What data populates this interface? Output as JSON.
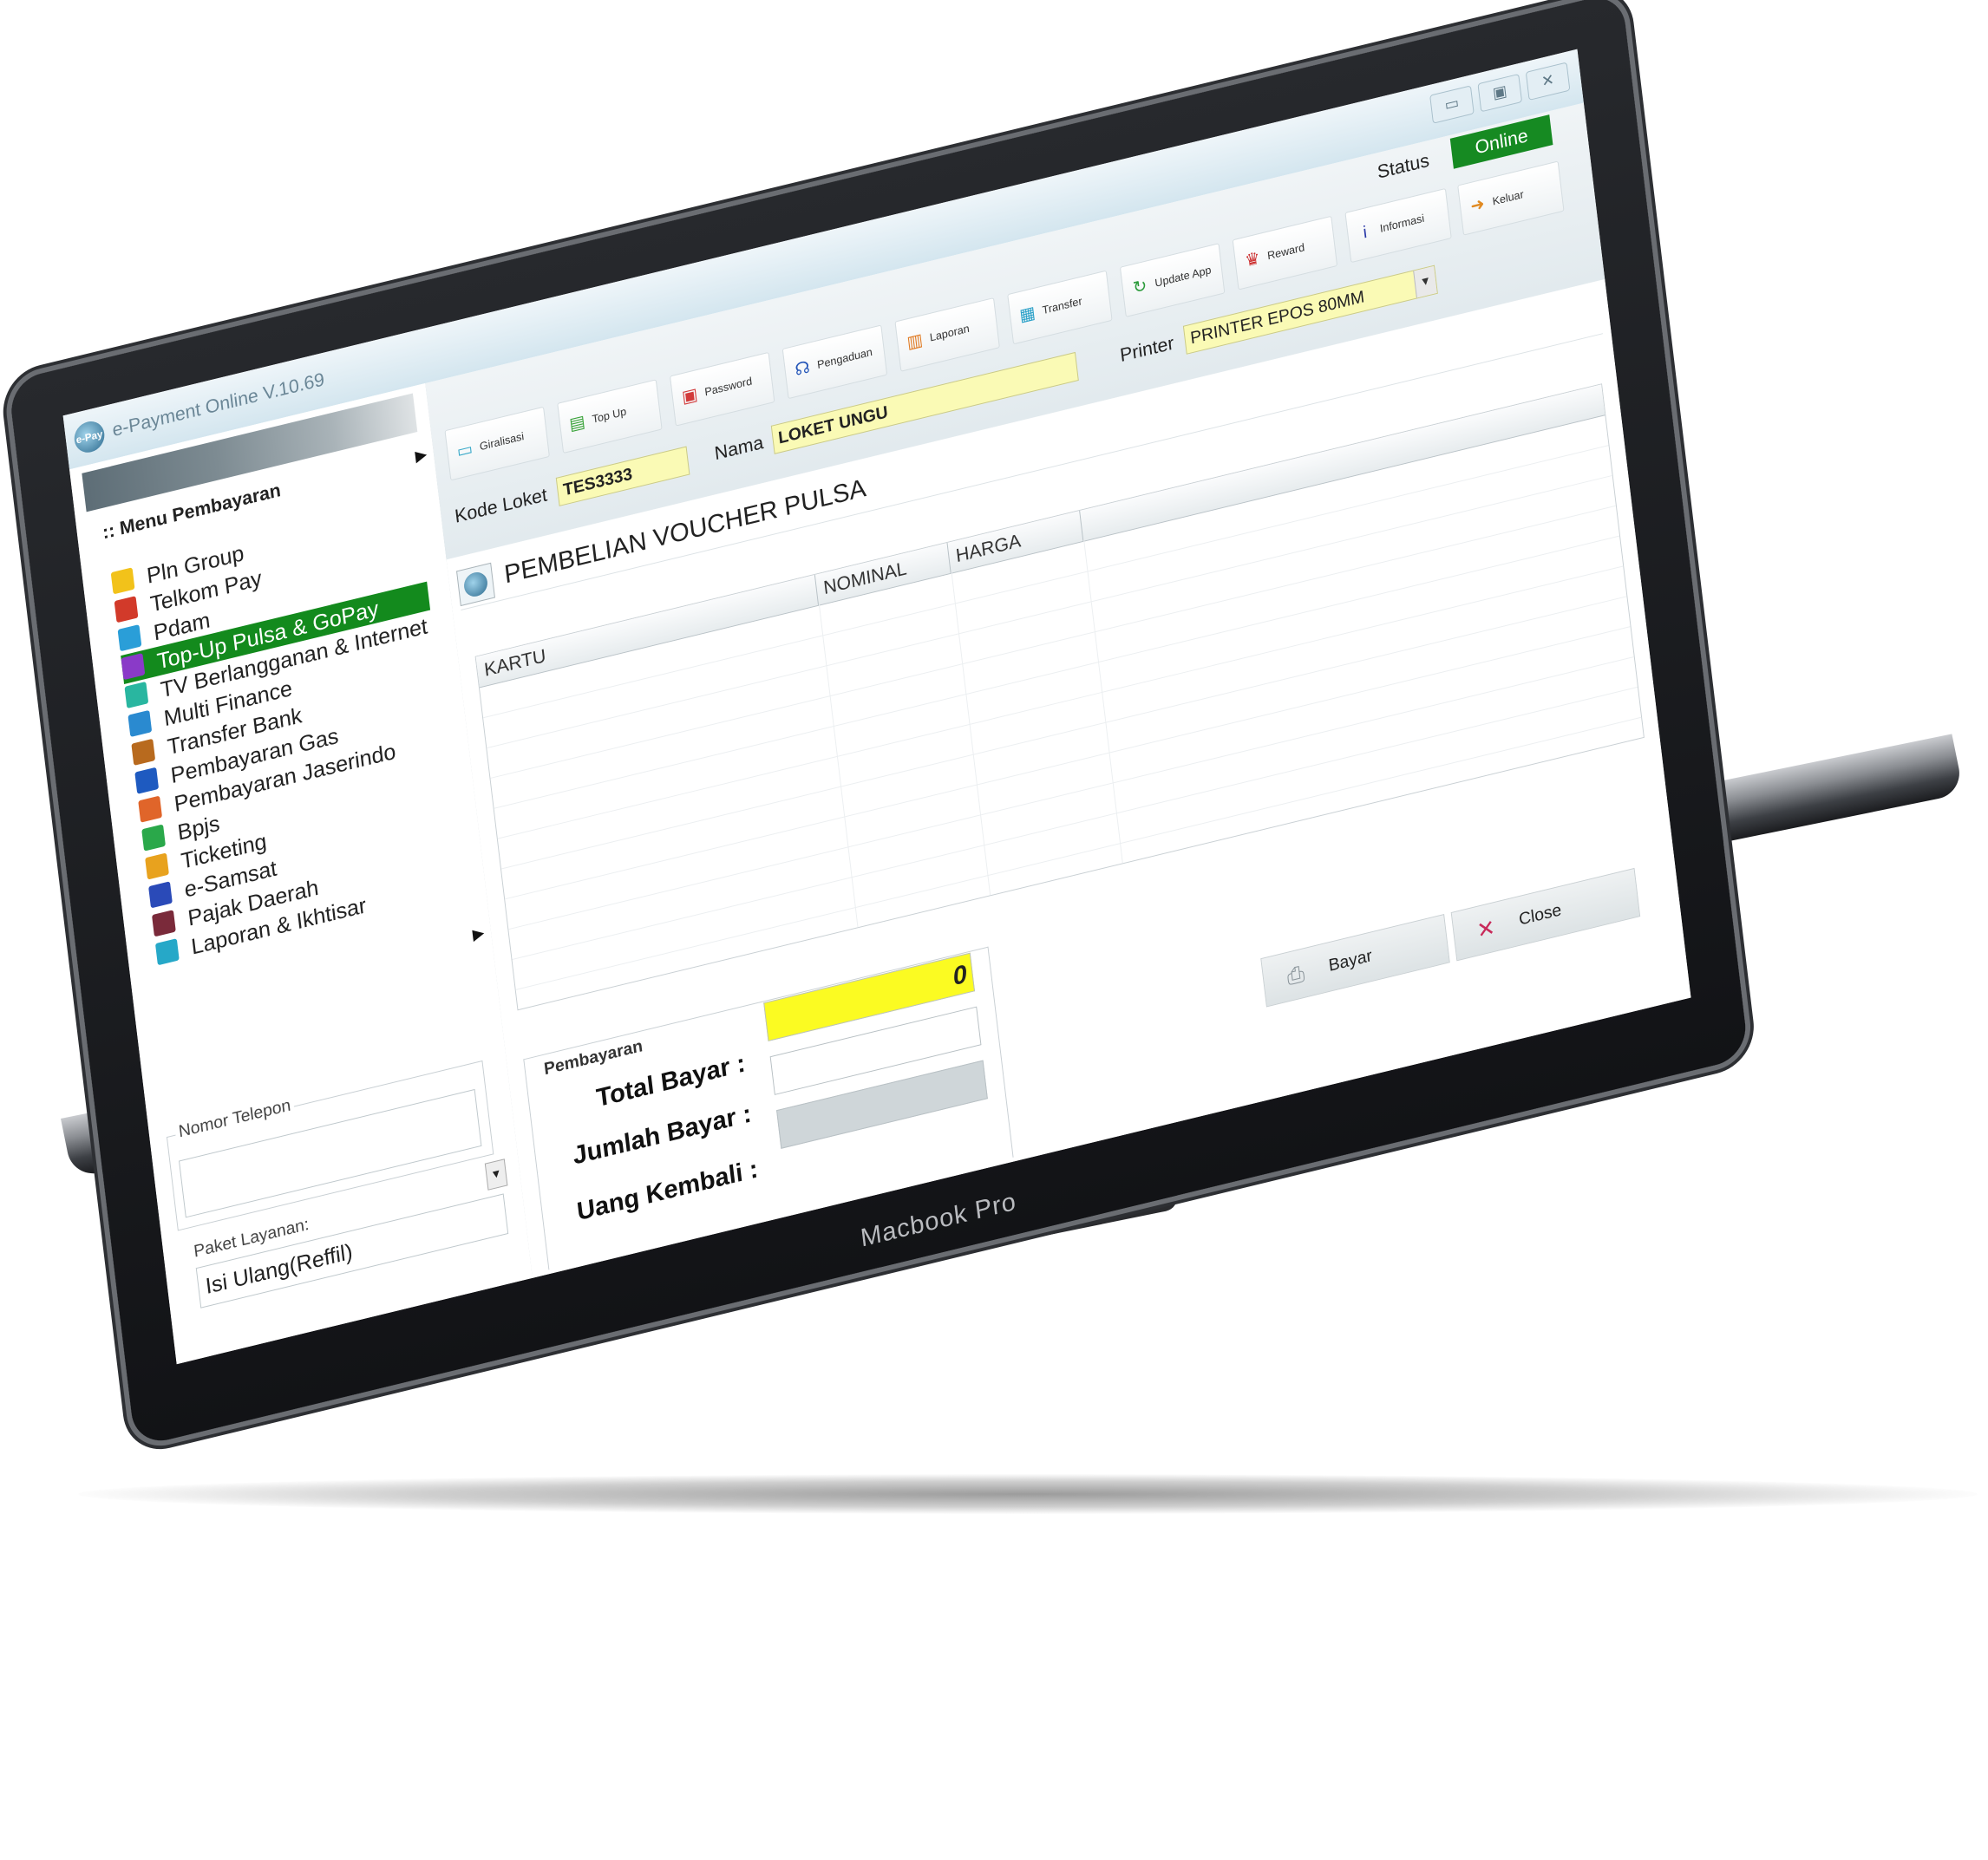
{
  "window": {
    "title": "e-Payment Online V.10.69",
    "logo_text": "e-Pay",
    "controls": [
      "▭",
      "▣",
      "✕"
    ]
  },
  "header": {
    "kode_loket_label": "Kode Loket",
    "kode_loket_value": "TES3333",
    "nama_label": "Nama",
    "nama_value": "LOKET UNGU",
    "printer_label": "Printer",
    "printer_value": "PRINTER EPOS 80MM",
    "status_label": "Status",
    "status_value": "Online",
    "status_color": "#168a22"
  },
  "toolbar": [
    {
      "label": "Giralisasi",
      "icon": "card-icon",
      "glyph": "▭",
      "color": "#39a9c9"
    },
    {
      "label": "Top Up",
      "icon": "wallet-icon",
      "glyph": "▤",
      "color": "#3aa33a"
    },
    {
      "label": "Password",
      "icon": "lock-icon",
      "glyph": "▣",
      "color": "#d23b3b"
    },
    {
      "label": "Pengaduan",
      "icon": "headset-icon",
      "glyph": "☊",
      "color": "#2455b8"
    },
    {
      "label": "Laporan",
      "icon": "clipboard-icon",
      "glyph": "▥",
      "color": "#e07a22"
    },
    {
      "label": "Transfer",
      "icon": "money-icon",
      "glyph": "▦",
      "color": "#2aa0c8"
    },
    {
      "label": "Update App",
      "icon": "refresh-icon",
      "glyph": "↻",
      "color": "#2a9a3a"
    },
    {
      "label": "Reward",
      "icon": "trophy-icon",
      "glyph": "♛",
      "color": "#cc2d2d"
    },
    {
      "label": "Informasi",
      "icon": "info-icon",
      "glyph": "i",
      "color": "#2a3aa8"
    },
    {
      "label": "Keluar",
      "icon": "exit-icon",
      "glyph": "➜",
      "color": "#e08a22"
    }
  ],
  "sidebar": {
    "heading": ":: Menu Pembayaran",
    "items": [
      {
        "label": "Pln Group",
        "color": "#f2c21a"
      },
      {
        "label": "Telkom Pay",
        "color": "#d23a2a"
      },
      {
        "label": "Pdam",
        "color": "#2a9ed8"
      },
      {
        "label": "Top-Up Pulsa & GoPay",
        "color": "#8a3ac8",
        "active": true
      },
      {
        "label": "TV Berlangganan & Internet",
        "color": "#29b6a0"
      },
      {
        "label": "Multi Finance",
        "color": "#2a8ad0"
      },
      {
        "label": "Transfer Bank",
        "color": "#b86a1e"
      },
      {
        "label": "Pembayaran Gas",
        "color": "#1e5ac0"
      },
      {
        "label": "Pembayaran Jaserindo",
        "color": "#e0652a"
      },
      {
        "label": "Bpjs",
        "color": "#2aa84a"
      },
      {
        "label": "Ticketing",
        "color": "#e8a21e"
      },
      {
        "label": "e-Samsat",
        "color": "#2a4ab8"
      },
      {
        "label": "Pajak Daerah",
        "color": "#7a2a3a"
      },
      {
        "label": "Laporan & Ikhtisar",
        "color": "#26a8c8"
      }
    ],
    "nomor_label": "Nomor Telepon",
    "nomor_value": "",
    "paket_label": "Paket Layanan:",
    "paket_value": "Isi Ulang(Reffil)"
  },
  "main": {
    "title": "PEMBELIAN VOUCHER PULSA",
    "columns": [
      "KARTU",
      "NOMINAL",
      "HARGA",
      ""
    ],
    "rows": []
  },
  "payment": {
    "caption": "Pembayaran",
    "total_label": "Total Bayar :",
    "total_value": "0",
    "jumlah_label": "Jumlah Bayar :",
    "jumlah_value": "",
    "kembali_label": "Uang Kembali :",
    "kembali_value": "",
    "bayar_label": "Bayar",
    "close_label": "Close"
  },
  "device": {
    "brand": "Macbook Pro"
  }
}
